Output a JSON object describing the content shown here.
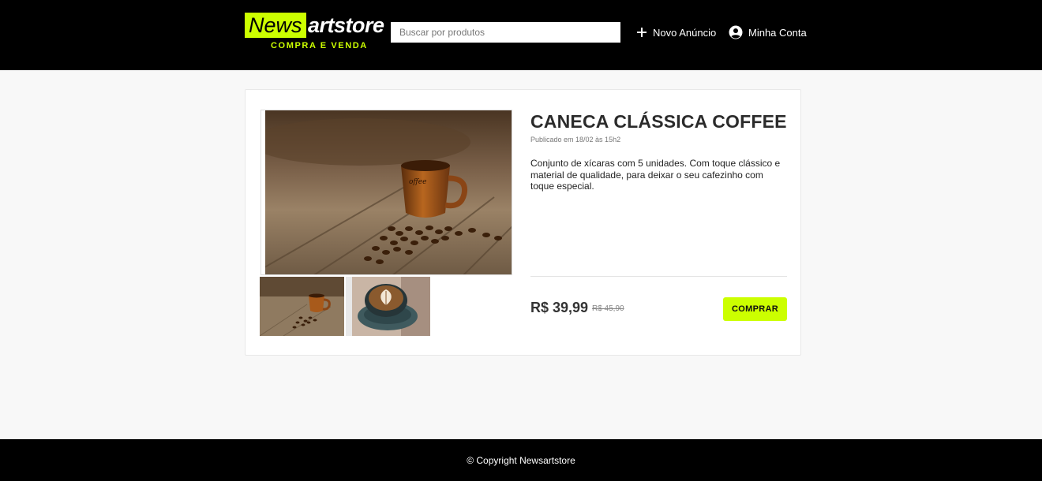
{
  "brand": {
    "part1": "News",
    "part2": "artstore",
    "tagline": "COMPRA E VENDA",
    "accent_color": "#ccff00"
  },
  "search": {
    "placeholder": "Buscar por produtos",
    "value": ""
  },
  "nav": {
    "new_ad": {
      "label": "Novo Anúncio",
      "icon": "plus-icon"
    },
    "account": {
      "label": "Minha Conta",
      "icon": "account-circle-icon"
    }
  },
  "product": {
    "title": "CANECA CLÁSSICA COFFEE",
    "published": "Publicado em 18/02 às 15h2",
    "description": "Conjunto de xícaras com 5 unidades. Com toque clássico e material de qualidade, para deixar o seu cafezinho com toque especial.",
    "price": "R$ 39,99",
    "old_price": "R$ 45,90",
    "buy_label": "COMPRAR",
    "images": [
      {
        "name": "wooden coffee cup with beans",
        "selected": true
      },
      {
        "name": "latte art cup"
      }
    ]
  },
  "footer": {
    "copyright": "© Copyright Newsartstore"
  }
}
